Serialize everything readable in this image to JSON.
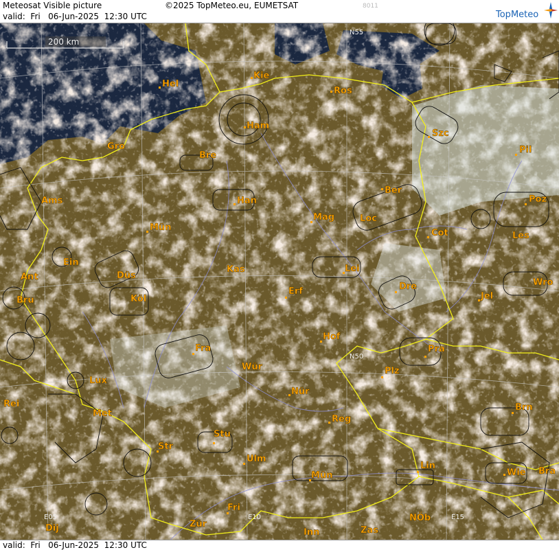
{
  "header": {
    "title": "Meteosat Visible picture",
    "copyright": "©2025 TopMeteo.eu, EUMETSAT",
    "valid_line": "valid:  Fri   06-Jun-2025  12:30 UTC",
    "code": "8011",
    "brand": "TopMeteo"
  },
  "footer": {
    "valid_line": "valid:  Fri   06-Jun-2025  12:30 UTC"
  },
  "scale_bar": {
    "label": "200 km"
  },
  "grid_labels": [
    {
      "id": "n55",
      "text": "N55"
    },
    {
      "id": "n50",
      "text": "N50"
    },
    {
      "id": "e05",
      "text": "E05"
    },
    {
      "id": "e10",
      "text": "E10"
    },
    {
      "id": "e15",
      "text": "E15"
    }
  ],
  "cities": [
    {
      "id": "hel",
      "label": "Hel"
    },
    {
      "id": "kie",
      "label": "Kie"
    },
    {
      "id": "ros",
      "label": "Ros"
    },
    {
      "id": "ham",
      "label": "Ham"
    },
    {
      "id": "szc",
      "label": "Szc"
    },
    {
      "id": "gro",
      "label": "Gro"
    },
    {
      "id": "bre",
      "label": "Bre"
    },
    {
      "id": "pil",
      "label": "Pil"
    },
    {
      "id": "ber",
      "label": "Ber"
    },
    {
      "id": "ams",
      "label": "Ams"
    },
    {
      "id": "han",
      "label": "Han"
    },
    {
      "id": "poz",
      "label": "Poz"
    },
    {
      "id": "mag",
      "label": "Mag"
    },
    {
      "id": "loc",
      "label": "Loc"
    },
    {
      "id": "mun",
      "label": "Mün"
    },
    {
      "id": "cot",
      "label": "Cot"
    },
    {
      "id": "les",
      "label": "Les"
    },
    {
      "id": "ein",
      "label": "Ein"
    },
    {
      "id": "kas",
      "label": "Kas"
    },
    {
      "id": "lei",
      "label": "Lei"
    },
    {
      "id": "ant",
      "label": "Ant"
    },
    {
      "id": "dus",
      "label": "Düs"
    },
    {
      "id": "wro",
      "label": "Wro"
    },
    {
      "id": "dre",
      "label": "Dre"
    },
    {
      "id": "bru",
      "label": "Bru"
    },
    {
      "id": "kol",
      "label": "Köl"
    },
    {
      "id": "erf",
      "label": "Erf"
    },
    {
      "id": "jel",
      "label": "Jel"
    },
    {
      "id": "hof",
      "label": "Hof"
    },
    {
      "id": "fra",
      "label": "Fra"
    },
    {
      "id": "pra",
      "label": "Pra"
    },
    {
      "id": "wur",
      "label": "Wür"
    },
    {
      "id": "plz",
      "label": "Plz"
    },
    {
      "id": "lux",
      "label": "Lux"
    },
    {
      "id": "nur",
      "label": "Nür"
    },
    {
      "id": "rei",
      "label": "Rei"
    },
    {
      "id": "met",
      "label": "Met"
    },
    {
      "id": "reg",
      "label": "Reg"
    },
    {
      "id": "brn",
      "label": "Brn"
    },
    {
      "id": "stu",
      "label": "Stu"
    },
    {
      "id": "str",
      "label": "Str"
    },
    {
      "id": "ulm",
      "label": "Ulm"
    },
    {
      "id": "lin",
      "label": "Lin"
    },
    {
      "id": "munich",
      "label": "Mün"
    },
    {
      "id": "wie",
      "label": "Wie"
    },
    {
      "id": "bra",
      "label": "Bra"
    },
    {
      "id": "fri",
      "label": "Fri"
    },
    {
      "id": "nob",
      "label": "NÖb"
    },
    {
      "id": "dij",
      "label": "Dij"
    },
    {
      "id": "zur",
      "label": "Zür"
    },
    {
      "id": "inn",
      "label": "Inn"
    },
    {
      "id": "zas",
      "label": "Zas"
    }
  ],
  "colors": {
    "sea": "#1b2840",
    "land": "#6b5a2c",
    "cloud": "#e8d4c0",
    "border": "#f2ef1a",
    "river": "#8f8fd6",
    "grid": "#c8c8c8",
    "city_label": "#ffa300"
  }
}
